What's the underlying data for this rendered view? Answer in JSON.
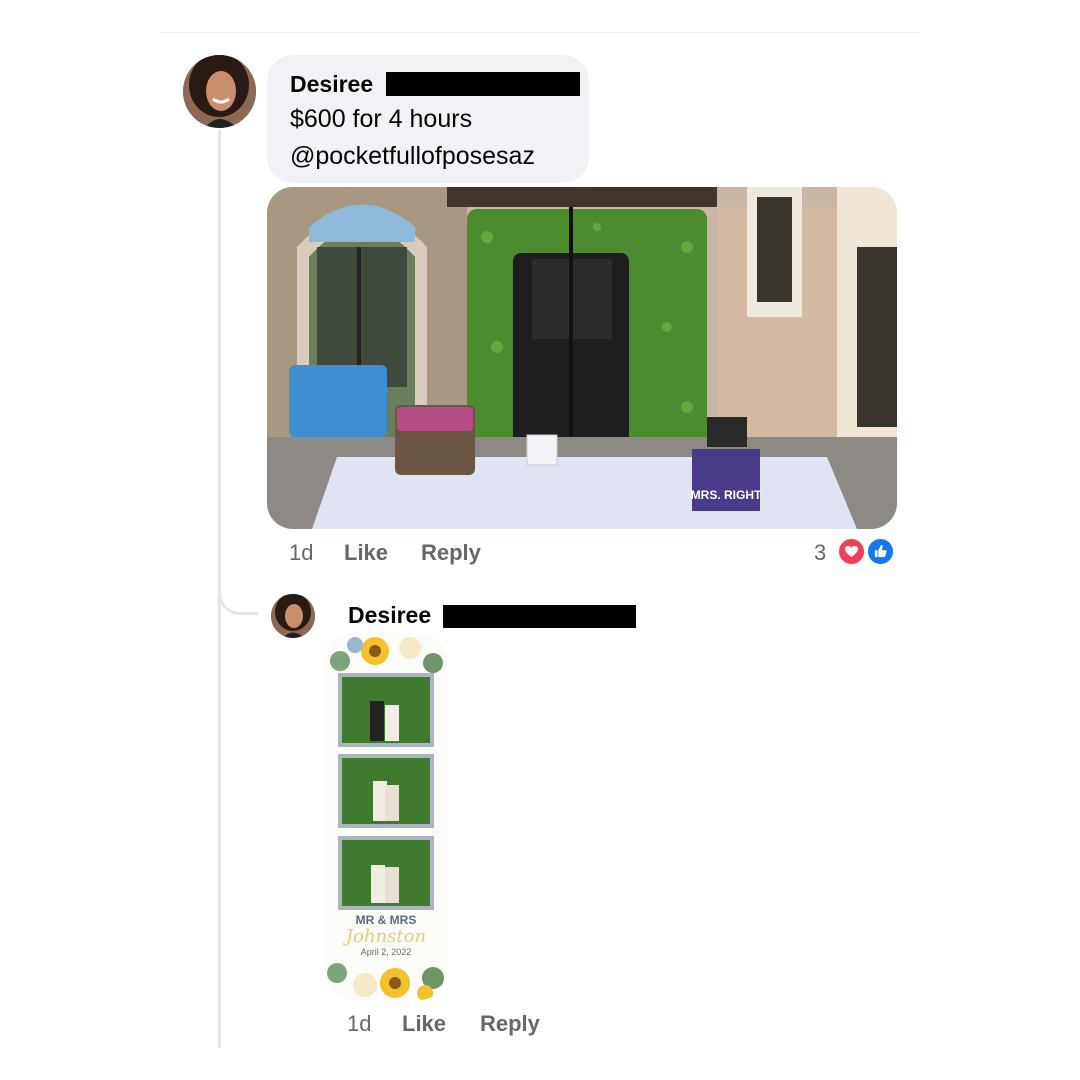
{
  "post_comment": {
    "author": "Desiree",
    "lines": [
      "$600 for 4 hours",
      "@pocketfullofposesaz"
    ],
    "photo_sign_text": "MRS. RIGHT",
    "time": "1d",
    "like_label": "Like",
    "reply_label": "Reply",
    "reaction_count": "3",
    "reactions": [
      "heart-icon",
      "thumbs-up-icon"
    ],
    "reaction_colors": {
      "heart": "#f33e58",
      "like": "#1877f2"
    }
  },
  "reply_comment": {
    "author": "Desiree",
    "strip": {
      "title": "MR & MRS",
      "script_name": "Johnston",
      "date": "April 2, 2022"
    },
    "time": "1d",
    "like_label": "Like",
    "reply_label": "Reply"
  },
  "colors": {
    "bubble": "#f0f2f5",
    "meta_text": "#65676b",
    "thread_line": "#e4e6eb"
  }
}
